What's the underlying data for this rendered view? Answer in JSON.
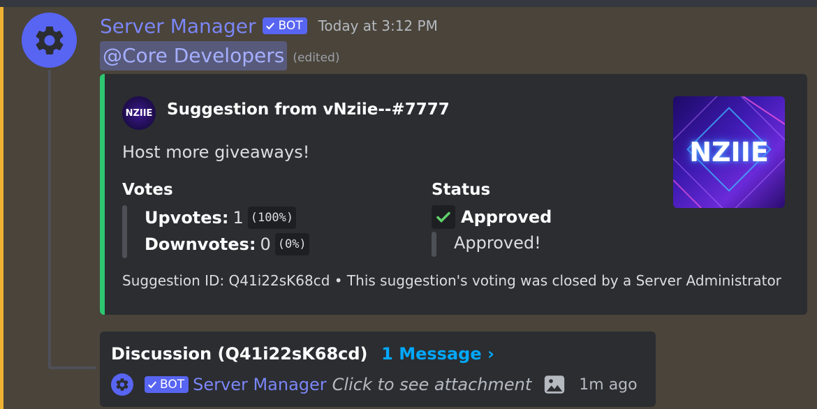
{
  "message": {
    "author": "Server Manager",
    "bot_badge": "BOT",
    "timestamp": "Today at 3:12 PM",
    "mention": "@Core Developers",
    "edited": "(edited)"
  },
  "embed": {
    "accent_color": "#2dc770",
    "author_icon_text": "NZIIE",
    "title": "Suggestion from vNziie--#7777",
    "description": "Host more giveaways!",
    "thumbnail_text": "NZIIE",
    "fields": {
      "votes": {
        "name": "Votes",
        "upvotes_label": "Upvotes:",
        "upvotes_value": "1",
        "upvotes_pct": "(100%)",
        "downvotes_label": "Downvotes:",
        "downvotes_value": "0",
        "downvotes_pct": "(0%)"
      },
      "status": {
        "name": "Status",
        "value_bold": "Approved",
        "value_note": "Approved!"
      }
    },
    "footer": "Suggestion ID: Q41i22sK68cd • This suggestion's voting was closed by a Server Administrator"
  },
  "thread": {
    "name": "Discussion (Q41i22sK68cd)",
    "message_count": "1 Message ›",
    "last_author": "Server Manager",
    "last_bot_badge": "BOT",
    "last_message": "Click to see attachment",
    "last_time": "1m ago"
  },
  "colors": {
    "brand": "#5865f2",
    "link": "#00a8fc",
    "mention_bg": "#585a7c",
    "highlight_stripe": "#f0b232"
  }
}
